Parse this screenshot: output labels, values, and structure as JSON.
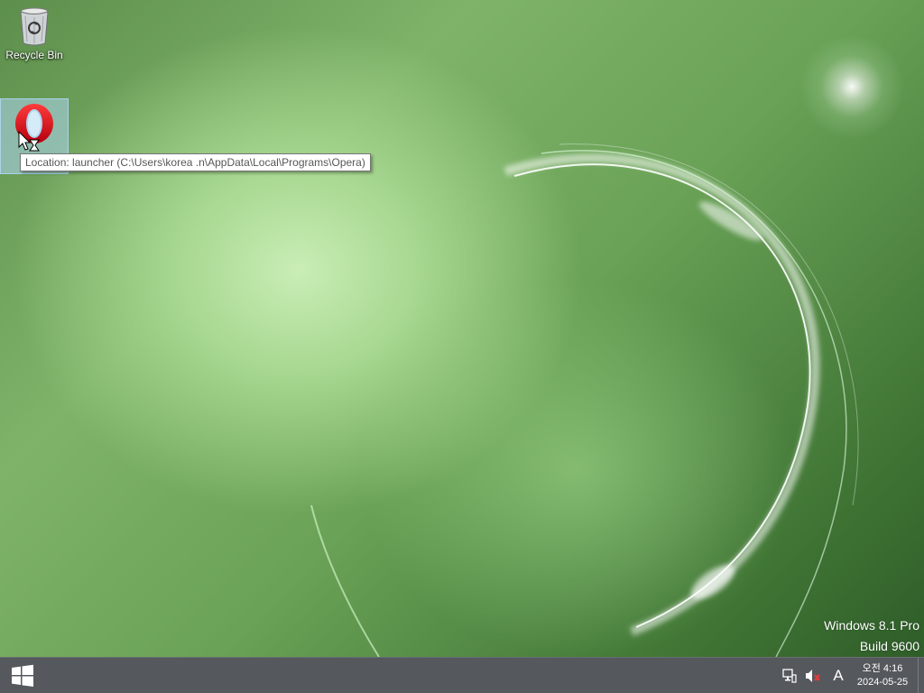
{
  "desktop": {
    "icons": [
      {
        "label": "Recycle Bin",
        "icon": "recycle-bin-icon"
      },
      {
        "label": "",
        "icon": "opera-icon"
      }
    ],
    "tooltip": "Location: launcher (C:\\Users\\korea .n\\AppData\\Local\\Programs\\Opera)",
    "watermark": {
      "line1": "Windows 8.1 Pro",
      "line2": "Build 9600"
    }
  },
  "taskbar": {
    "start_icon": "windows-logo-icon",
    "tray": {
      "icons": [
        "network-icon",
        "volume-muted-icon"
      ],
      "ime_indicator": "A",
      "clock": {
        "time": "오전 4:16",
        "date": "2024-05-25"
      }
    }
  },
  "colors": {
    "taskbar": "#55595d",
    "selection": "#add6f2",
    "wallpaper": "#6aa257"
  }
}
